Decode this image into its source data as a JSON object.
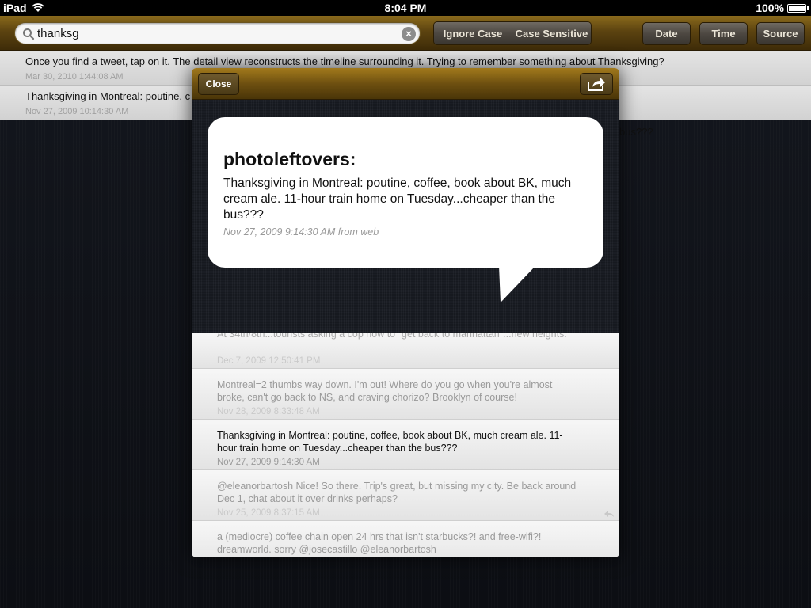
{
  "status_bar": {
    "device": "iPad",
    "time": "8:04 PM",
    "battery": "100%",
    "battery_level": 1.0
  },
  "toolbar": {
    "search_value": "thanksg",
    "segments": [
      "Ignore Case",
      "Case Sensitive"
    ],
    "sort_buttons": [
      "Date",
      "Time",
      "Source"
    ]
  },
  "results": [
    {
      "text": "Once you find a tweet, tap on it. The detail view reconstructs the timeline surrounding it. Trying to remember something about Thanksgiving?",
      "date": "Mar 30, 2010 1:44:08 AM"
    },
    {
      "text": "Thanksgiving in Montreal: poutine, c",
      "text_tail": "bus???",
      "date": "Nov 27, 2009 10:14:30 AM"
    }
  ],
  "modal": {
    "close_label": "Close",
    "bubble": {
      "user": "photoleftovers:",
      "text": "Thanksgiving in Montreal: poutine, coffee, book about BK, much cream ale. 11-hour train home on Tuesday...cheaper than the bus???",
      "meta": "Nov 27, 2009 9:14:30 AM from web"
    },
    "timeline": [
      {
        "text": "At 34th/8th...tourists asking a cop how to \"get back to manhattan\"...new heights.",
        "date": "Dec 7, 2009 12:50:41 PM"
      },
      {
        "text": "Montreal=2 thumbs way down. I'm out! Where do you go when you're almost broke, can't go back to NS, and craving chorizo? Brooklyn of course!",
        "date": "Nov 28, 2009 8:33:48 AM"
      },
      {
        "text": "Thanksgiving in Montreal: poutine, coffee, book about BK, much cream ale. 11-hour train home on Tuesday...cheaper than the bus???",
        "date": "Nov 27, 2009 9:14:30 AM"
      },
      {
        "text": "@eleanorbartosh Nice! So there. Trip's great, but missing my city. Be back around Dec 1, chat about it over drinks perhaps?",
        "date": "Nov 25, 2009 8:37:15 AM"
      },
      {
        "text": "a (mediocre) coffee chain open 24 hrs that isn't starbucks?! and free-wifi?! dreamworld. sorry @josecastillo @eleanorbartosh",
        "date": ""
      }
    ]
  }
}
